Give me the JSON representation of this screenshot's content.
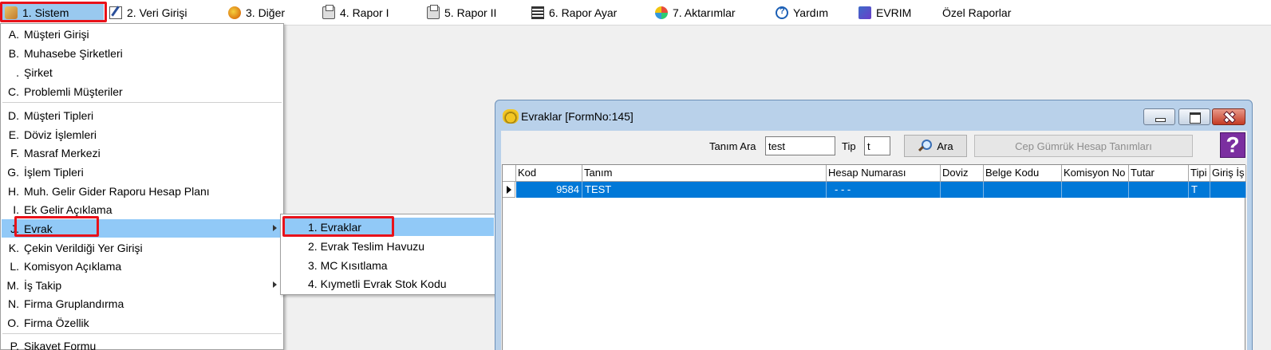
{
  "menubar": {
    "items": [
      {
        "label": "1.  Sistem",
        "icon": "system-icon"
      },
      {
        "label": "2.  Veri Girişi",
        "icon": "data-entry-icon"
      },
      {
        "label": "3.  Diğer",
        "icon": "other-icon"
      },
      {
        "label": "4.  Rapor I",
        "icon": "printer-icon"
      },
      {
        "label": "5.  Rapor II",
        "icon": "printer-icon"
      },
      {
        "label": "6.  Rapor Ayar",
        "icon": "report-settings-icon"
      },
      {
        "label": "7.  Aktarımlar",
        "icon": "transfer-icon"
      },
      {
        "label": "Yardım",
        "icon": "help-icon"
      },
      {
        "label": "EVRIM",
        "icon": "book-icon"
      },
      {
        "label": "Özel Raporlar",
        "icon": ""
      }
    ]
  },
  "dropdown": {
    "items": [
      {
        "key": "A.",
        "label": "Müşteri Girişi"
      },
      {
        "key": "B.",
        "label": "Muhasebe Şirketleri"
      },
      {
        "key": ".",
        "label": "Şirket"
      },
      {
        "key": "C.",
        "label": "Problemli Müşteriler"
      },
      {
        "key": "D.",
        "label": "Müşteri Tipleri"
      },
      {
        "key": "E.",
        "label": "Döviz İşlemleri"
      },
      {
        "key": "F.",
        "label": "Masraf Merkezi"
      },
      {
        "key": "G.",
        "label": "İşlem Tipleri"
      },
      {
        "key": "H.",
        "label": "Muh. Gelir Gider Raporu Hesap Planı"
      },
      {
        "key": "I.",
        "label": "Ek Gelir Açıklama"
      },
      {
        "key": "J.",
        "label": "Evrak"
      },
      {
        "key": "K.",
        "label": "Çekin Verildiği Yer Girişi"
      },
      {
        "key": "L.",
        "label": "Komisyon Açıklama"
      },
      {
        "key": "M.",
        "label": "İş Takip"
      },
      {
        "key": "N.",
        "label": "Firma Gruplandırma"
      },
      {
        "key": "O.",
        "label": "Firma Özellik"
      },
      {
        "key": "P.",
        "label": "Şikayet Formu"
      }
    ]
  },
  "submenu": {
    "items": [
      {
        "label": "1.   Evraklar"
      },
      {
        "label": "2.   Evrak Teslim Havuzu"
      },
      {
        "label": "3.   MC Kısıtlama"
      },
      {
        "label": "4. Kıymetli Evrak Stok Kodu"
      }
    ]
  },
  "window": {
    "title": "Evraklar [FormNo:145]",
    "search_label": "Tanım Ara",
    "search_value": "test",
    "tip_label": "Tip",
    "tip_value": "t",
    "search_button": "Ara",
    "cep_button": "Cep Gümrük Hesap Tanımları",
    "help_glyph": "?",
    "grid": {
      "columns": [
        "Kod",
        "Tanım",
        "Hesap Numarası",
        "Doviz",
        "Belge Kodu",
        "Komisyon No",
        "Tutar",
        "Tipi",
        "Giriş İş"
      ],
      "rows": [
        [
          "9584",
          "TEST",
          "- -  -",
          "",
          "",
          "",
          "",
          "T",
          ""
        ]
      ]
    }
  },
  "colors": {
    "highlight": "#91c9f7",
    "selection_row": "#0078d7",
    "red_marker": "#e8121a",
    "window_frame": "#b9d1ea"
  }
}
